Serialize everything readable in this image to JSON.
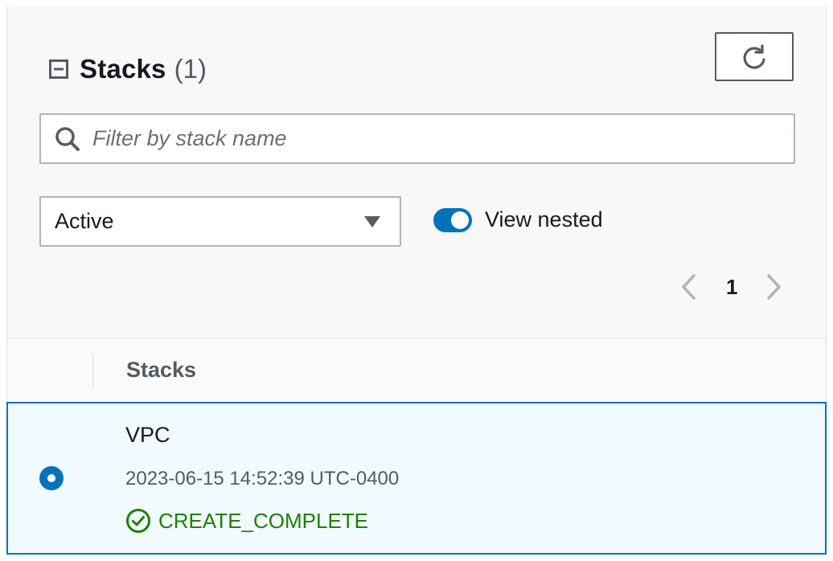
{
  "header": {
    "title": "Stacks",
    "count": "(1)"
  },
  "search": {
    "placeholder": "Filter by stack name",
    "value": ""
  },
  "filter": {
    "selected": "Active"
  },
  "view_nested": {
    "label": "View nested",
    "enabled": true
  },
  "pagination": {
    "current_page": "1"
  },
  "table": {
    "column_header": "Stacks",
    "rows": [
      {
        "name": "VPC",
        "timestamp": "2023-06-15 14:52:39 UTC-0400",
        "status": "CREATE_COMPLETE",
        "selected": true
      }
    ]
  },
  "colors": {
    "accent": "#0073bb",
    "success": "#1d8102",
    "selected_row_bg": "#f1faff"
  },
  "icons": {
    "collapse": "collapse-icon",
    "refresh": "refresh-icon",
    "search": "search-icon",
    "caret": "caret-down-icon",
    "prev": "chevron-left-icon",
    "next": "chevron-right-icon",
    "status": "check-circle-icon"
  }
}
